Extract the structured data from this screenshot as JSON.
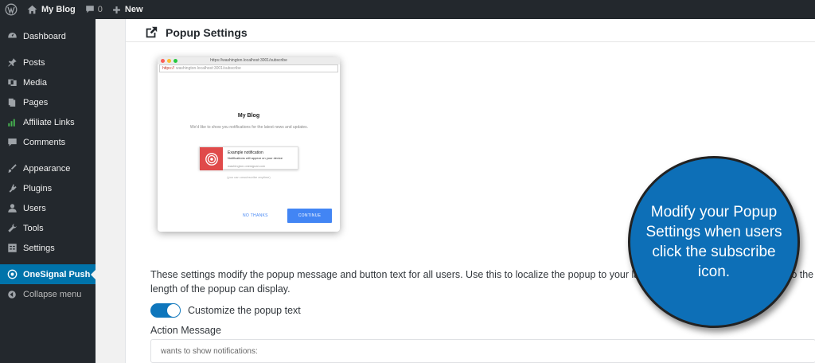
{
  "adminbar": {
    "site": "My Blog",
    "comments_count": "0",
    "new_label": "New"
  },
  "sidebar": {
    "items": [
      {
        "label": "Dashboard",
        "icon": "dashboard-icon"
      },
      {
        "label": "Posts",
        "icon": "pin-icon"
      },
      {
        "label": "Media",
        "icon": "media-icon"
      },
      {
        "label": "Pages",
        "icon": "pages-icon"
      },
      {
        "label": "Affiliate Links",
        "icon": "affiliate-icon"
      },
      {
        "label": "Comments",
        "icon": "comments-icon"
      },
      {
        "label": "Appearance",
        "icon": "appearance-icon"
      },
      {
        "label": "Plugins",
        "icon": "plugins-icon"
      },
      {
        "label": "Users",
        "icon": "users-icon"
      },
      {
        "label": "Tools",
        "icon": "tools-icon"
      },
      {
        "label": "Settings",
        "icon": "settings-icon"
      },
      {
        "label": "OneSignal Push",
        "icon": "onesignal-icon"
      },
      {
        "label": "Collapse menu",
        "icon": "collapse-icon"
      }
    ]
  },
  "section": {
    "title": "Popup Settings"
  },
  "preview": {
    "tab_url": "https://washington.localhost:3001/subscribe",
    "url_scheme": "https://",
    "url_rest": "washington.localhost:3001/subscribe",
    "site_name": "My Blog",
    "message": "We'd like to show you notifications for the latest news and updates.",
    "notif_title": "Example notification",
    "notif_body": "Notifications will appear on your device",
    "notif_site": "washington.onesignal.com",
    "unsubscribe_note": "(you can unsubscribe anytime)",
    "no_thanks": "NO THANKS",
    "continue": "CONTINUE"
  },
  "settings": {
    "description": "These settings modify the popup message and button text for all users. Use this to localize the popup to your language. All fields here are limited to the length of the popup can display.",
    "toggle_label": "Customize the popup text",
    "toggle_on": true,
    "action_message_label": "Action Message",
    "action_message_value": "wants to show notifications:"
  },
  "callout": {
    "text": "Modify your Popup Settings when users click the subscribe icon."
  },
  "colors": {
    "admin_dark": "#23282d",
    "active_blue": "#0073aa",
    "callout_blue": "#0d6fb7",
    "toggle_blue": "#0e76bc"
  }
}
